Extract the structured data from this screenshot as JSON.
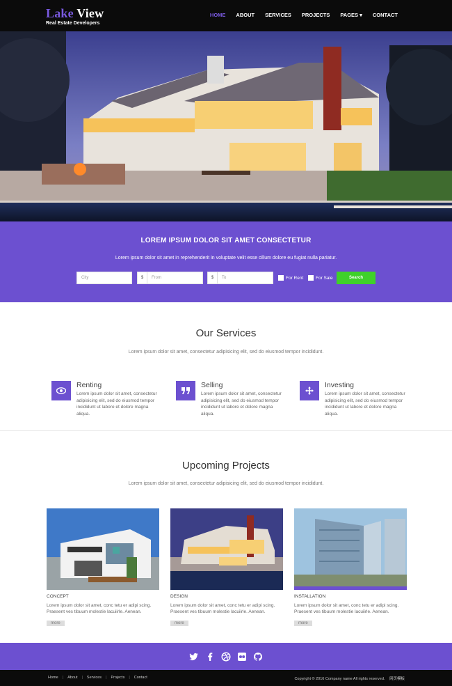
{
  "brand": {
    "name_part1": "Lake",
    "name_part2": "View",
    "tagline": "Real Estate Developers"
  },
  "nav": [
    {
      "label": "HOME",
      "active": true
    },
    {
      "label": "ABOUT"
    },
    {
      "label": "SERVICES"
    },
    {
      "label": "PROJECTS"
    },
    {
      "label": "PAGES ▾"
    },
    {
      "label": "CONTACT"
    }
  ],
  "search": {
    "title": "LOREM IPSUM DOLOR SIT AMET CONSECTETUR",
    "text": "Lorem ipsum dolor sit amet in reprehenderit in voluptate velit esse cillum dolore eu fugiat nulla pariatur.",
    "city_placeholder": "City",
    "currency": "$",
    "from_placeholder": "From",
    "to_placeholder": "To",
    "for_rent": "For Rent",
    "for_sale": "For Sale",
    "button": "Search"
  },
  "services": {
    "title": "Our Services",
    "subtitle": "Lorem ipsum dolor sit amet, consectetur adipisicing elit, sed do eiusmod tempor incididunt.",
    "items": [
      {
        "title": "Renting",
        "text": "Lorem ipsum dolor sit amet, consectetur adipisicing elit, sed do eiusmod tempor incididunt ut labore et dolore magna aliqua.",
        "icon": "eye-icon"
      },
      {
        "title": "Selling",
        "text": "Lorem ipsum dolor sit amet, consectetur adipisicing elit, sed do eiusmod tempor incididunt ut labore et dolore magna aliqua.",
        "icon": "quote-icon"
      },
      {
        "title": "Investing",
        "text": "Lorem ipsum dolor sit amet, consectetur adipisicing elit, sed do eiusmod tempor incididunt ut labore et dolore magna aliqua.",
        "icon": "move-arrows-icon"
      }
    ]
  },
  "projects": {
    "title": "Upcoming Projects",
    "subtitle": "Lorem ipsum dolor sit amet, consectetur adipisicing elit, sed do eiusmod tempor incididunt.",
    "items": [
      {
        "label": "CONCEPT",
        "text": "Lorem ipsum dolor sit amet, conc tetu er adipi scing. Praesent ves tibuum molestie lacuiirle. Aenean.",
        "more": "more"
      },
      {
        "label": "DESIGN",
        "text": "Lorem ipsum dolor sit amet, conc tetu er adipi scing. Praesent ves tibuum molestie lacuiirle. Aenean.",
        "more": "more"
      },
      {
        "label": "INSTALLATION",
        "text": "Lorem ipsum dolor sit amet, conc tetu er adipi scing. Praesent ves tibuum molestie lacuiirle. Aenean.",
        "more": "more"
      }
    ]
  },
  "social_icons": [
    "twitter-icon",
    "facebook-icon",
    "dribbble-icon",
    "flickr-icon",
    "github-icon"
  ],
  "footer": {
    "links": [
      "Home",
      "About",
      "Services",
      "Projects",
      "Contact"
    ],
    "copyright": "Copyright © 2016 Company name All rights reserved.",
    "badge": "网页模板"
  },
  "colors": {
    "accent": "#6c50d0",
    "search_button": "#3fd12a",
    "header_bg": "#0b0b0b"
  }
}
